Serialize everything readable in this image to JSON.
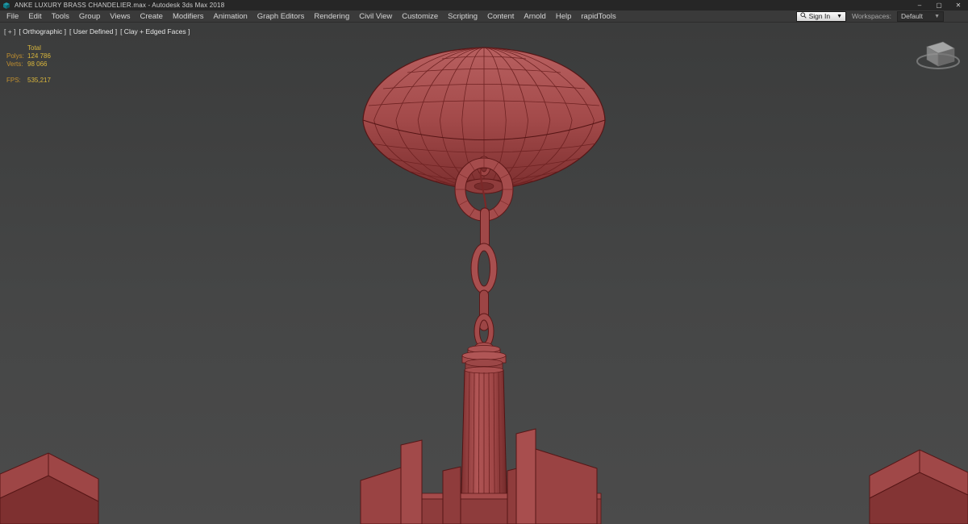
{
  "window": {
    "title": "ANKE LUXURY BRASS CHANDELIER.max - Autodesk 3ds Max 2018",
    "controls": {
      "minimize": "–",
      "maximize": "▢",
      "close": "✕"
    }
  },
  "menu": {
    "items": [
      "File",
      "Edit",
      "Tools",
      "Group",
      "Views",
      "Create",
      "Modifiers",
      "Animation",
      "Graph Editors",
      "Rendering",
      "Civil View",
      "Customize",
      "Scripting",
      "Content",
      "Arnold",
      "Help",
      "rapidTools"
    ]
  },
  "account": {
    "sign_in_label": "Sign In",
    "workspaces_label": "Workspaces:",
    "workspace_value": "Default"
  },
  "viewport": {
    "labels": {
      "plus": "[ + ]",
      "projection": "[ Orthographic ]",
      "view": "[ User Defined ]",
      "shading": "[ Clay + Edged Faces ]"
    },
    "stats": {
      "total_label": "Total",
      "polys_label": "Polys:",
      "polys_value": "124 786",
      "verts_label": "Verts:",
      "verts_value": "98 066",
      "fps_label": "FPS:",
      "fps_value": "535,217"
    }
  },
  "colors": {
    "clay": "#a84f4f",
    "clay_edge": "#5c1818",
    "stats_text": "#d2a93a",
    "viewport_bg": "#424242"
  }
}
